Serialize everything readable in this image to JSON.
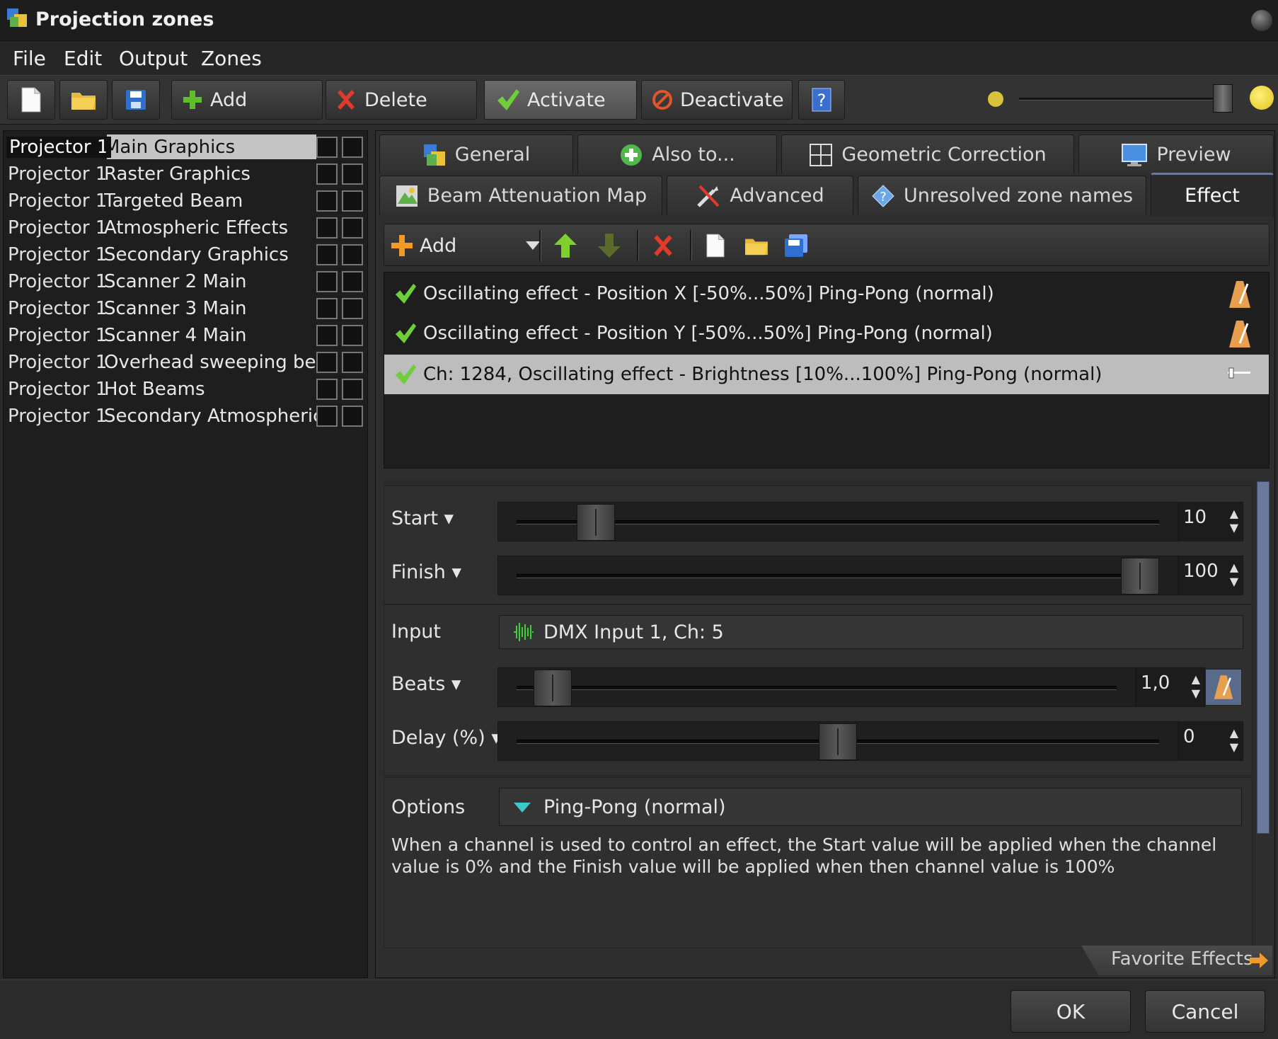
{
  "window": {
    "title": "Projection zones"
  },
  "menu": [
    "File",
    "Edit",
    "Output",
    "Zones"
  ],
  "toolbar": {
    "add_label": "Add",
    "delete_label": "Delete",
    "activate_label": "Activate",
    "deactivate_label": "Deactivate"
  },
  "zones": [
    {
      "projector": "Projector 1",
      "name": "Main Graphics"
    },
    {
      "projector": "Projector 1",
      "name": "Raster Graphics"
    },
    {
      "projector": "Projector 1",
      "name": "Targeted Beam"
    },
    {
      "projector": "Projector 1",
      "name": "Atmospheric Effects"
    },
    {
      "projector": "Projector 1",
      "name": "Secondary Graphics"
    },
    {
      "projector": "Projector 1",
      "name": "Scanner 2 Main"
    },
    {
      "projector": "Projector 1",
      "name": "Scanner 3 Main"
    },
    {
      "projector": "Projector 1",
      "name": "Scanner 4 Main"
    },
    {
      "projector": "Projector 1",
      "name": "Overhead sweeping beams"
    },
    {
      "projector": "Projector 1",
      "name": "Hot Beams"
    },
    {
      "projector": "Projector 1",
      "name": "Secondary Atmospheric"
    }
  ],
  "tabs": {
    "row1": [
      "General",
      "Also to...",
      "Geometric Correction",
      "Preview"
    ],
    "row2": [
      "Beam Attenuation Map",
      "Advanced",
      "Unresolved zone names",
      "Effect"
    ]
  },
  "effect_toolbar": {
    "add_label": "Add"
  },
  "effects": [
    "Oscillating effect - Position X [-50%...50%] Ping-Pong (normal)",
    "Oscillating effect - Position Y [-50%...50%] Ping-Pong (normal)",
    "Ch: 1284, Oscillating effect - Brightness [10%...100%] Ping-Pong (normal)"
  ],
  "params": {
    "start": {
      "label": "Start",
      "value": "10",
      "level": 10
    },
    "finish": {
      "label": "Finish",
      "value": "100",
      "level": 100
    },
    "input": {
      "label": "Input",
      "value": "DMX Input 1, Ch: 5"
    },
    "beats": {
      "label": "Beats",
      "value": "1,0",
      "level": 3
    },
    "delay": {
      "label": "Delay (%)",
      "value": "0",
      "level": 50
    },
    "options": {
      "label": "Options",
      "value": "Ping-Pong (normal)"
    }
  },
  "notice": "When a channel is used to control an effect, the Start value will be applied when the channel value is 0% and the Finish value will be applied when then channel value is 100%",
  "favorite_effects_label": "Favorite Effects",
  "buttons": {
    "ok": "OK",
    "cancel": "Cancel"
  },
  "colors": {
    "accent_green": "#6fcf3a",
    "delete_red": "#e03a2a",
    "selection": "#bdbdbd",
    "scroll_blue": "#6b7a9a"
  }
}
